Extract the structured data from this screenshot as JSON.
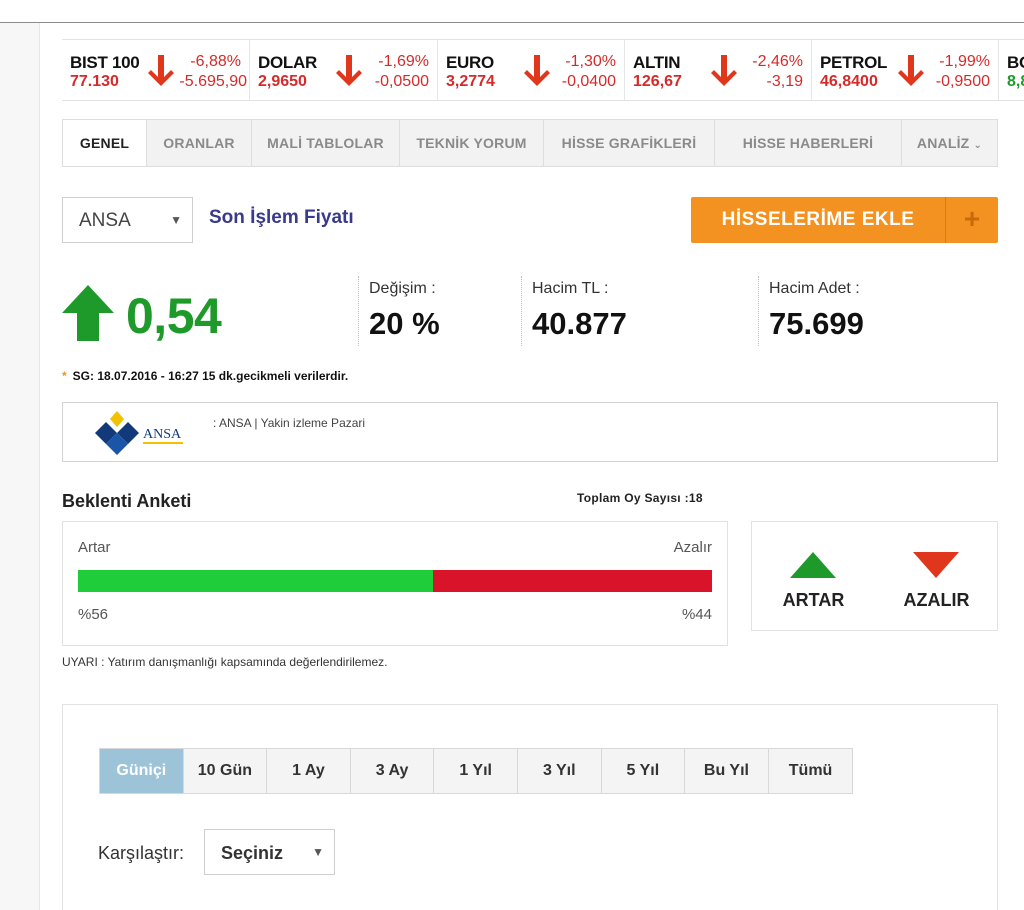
{
  "ticker": [
    {
      "name": "BIST 100",
      "price": "77.130",
      "pct": "-6,88%",
      "chg": "-5.695,90",
      "direction": "down"
    },
    {
      "name": "DOLAR",
      "price": "2,9650",
      "pct": "-1,69%",
      "chg": "-0,0500",
      "direction": "down"
    },
    {
      "name": "EURO",
      "price": "3,2774",
      "pct": "-1,30%",
      "chg": "-0,0400",
      "direction": "down"
    },
    {
      "name": "ALTIN",
      "price": "126,67",
      "pct": "-2,46%",
      "chg": "-3,19",
      "direction": "down"
    },
    {
      "name": "PETROL",
      "price": "46,8400",
      "pct": "-1,99%",
      "chg": "-0,9500",
      "direction": "down"
    },
    {
      "name": "BO",
      "price": "8,8",
      "pct": "",
      "chg": "",
      "direction": "up"
    }
  ],
  "tabs": [
    "GENEL",
    "ORANLAR",
    "MALİ TABLOLAR",
    "TEKNİK YORUM",
    "HİSSE GRAFİKLERİ",
    "HİSSE HABERLERİ",
    "ANALİZ"
  ],
  "symbol_select": {
    "value": "ANSA"
  },
  "last_price_label": "Son İşlem Fiyatı",
  "add_button": {
    "label": "HİSSELERİME EKLE",
    "plus": "+"
  },
  "price": {
    "value": "0,54",
    "direction": "up"
  },
  "stats": [
    {
      "label": "Değişim :",
      "value": "20 %"
    },
    {
      "label": "Hacim TL :",
      "value": "40.877"
    },
    {
      "label": "Hacim Adet :",
      "value": "75.699"
    }
  ],
  "note": {
    "star": "*",
    "text": "SG: 18.07.2016 - 16:27 15 dk.gecikmeli verilerdir."
  },
  "company": {
    "logo_text": "ANSA",
    "text": ": ANSA | Yakin izleme Pazari"
  },
  "survey": {
    "title": "Beklenti Anketi",
    "count_label": "Toplam Oy Sayısı :18",
    "left_label": "Artar",
    "right_label": "Azalır",
    "up_percent": 56,
    "up_percent_label": "%56",
    "down_percent_label": "%44",
    "vote_up": "ARTAR",
    "vote_down": "AZALIR"
  },
  "warning": "UYARI : Yatırım danışmanlığı kapsamında değerlendirilemez.",
  "periods": [
    "Güniçi",
    "10 Gün",
    "1 Ay",
    "3 Ay",
    "1 Yıl",
    "3 Yıl",
    "5 Yıl",
    "Bu Yıl",
    "Tümü"
  ],
  "active_period": 0,
  "compare": {
    "label": "Karşılaştır:",
    "value": "Seçiniz"
  },
  "colors": {
    "up": "#1e9a2a",
    "down": "#d62a2a",
    "accent": "#f39221",
    "bar_up": "#1fcc3a",
    "bar_down": "#d8132a"
  }
}
